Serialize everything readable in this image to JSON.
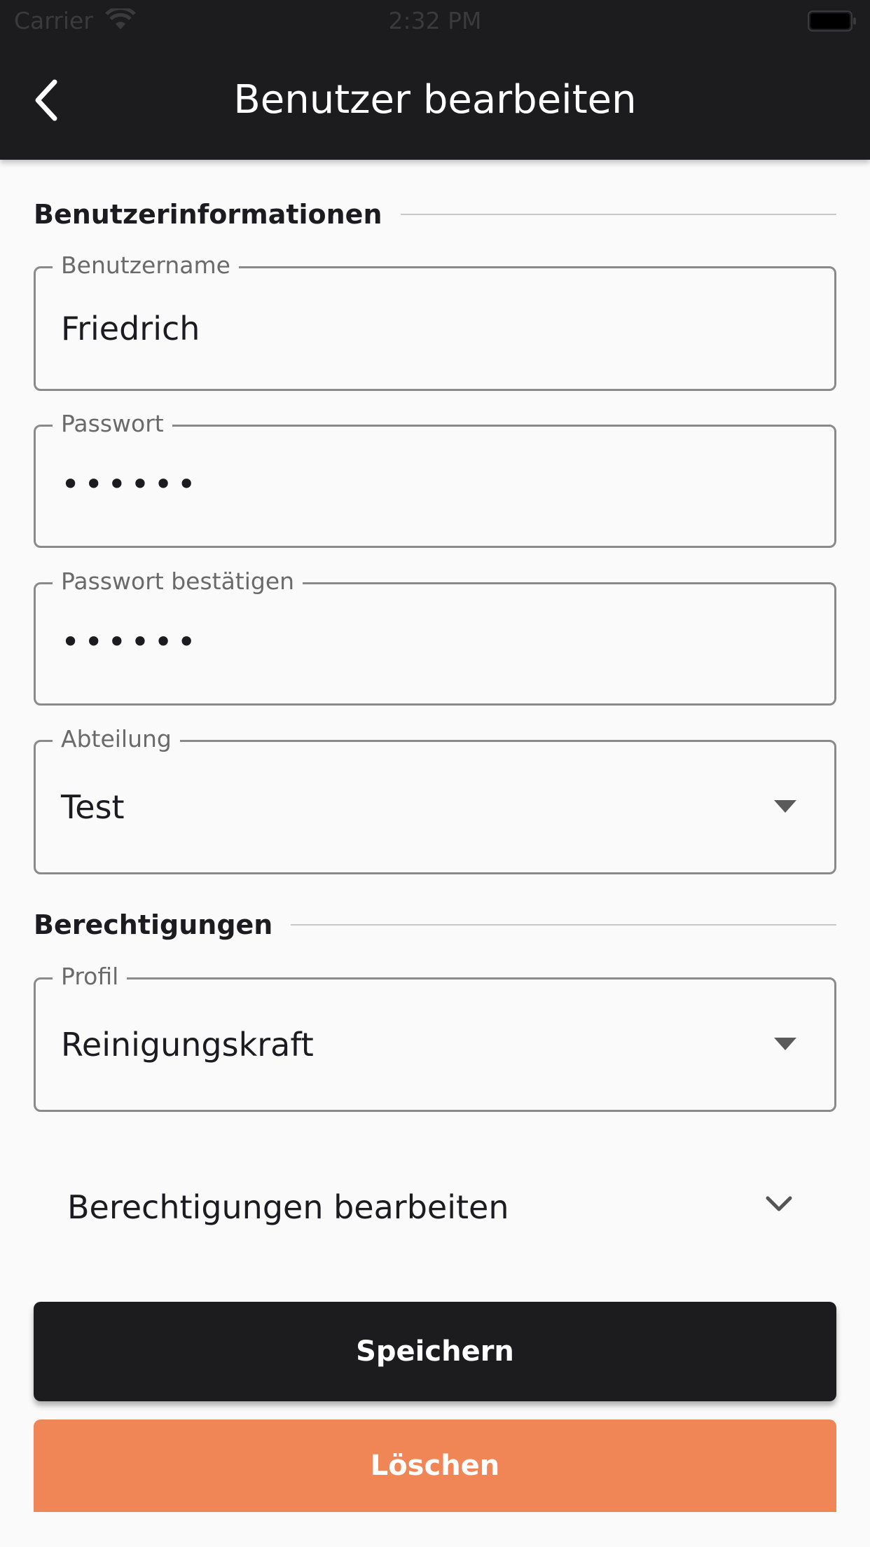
{
  "status_bar": {
    "carrier": "Carrier",
    "time": "2:32 PM"
  },
  "appbar": {
    "title": "Benutzer bearbeiten",
    "back_icon": "chevron-left-icon"
  },
  "section_user": {
    "title": "Benutzerinformationen"
  },
  "fields": {
    "username": {
      "label": "Benutzername",
      "value": "Friedrich"
    },
    "password": {
      "label": "Passwort",
      "value": "••••••"
    },
    "password_confirm": {
      "label": "Passwort bestätigen",
      "value": "••••••"
    },
    "department": {
      "label": "Abteilung",
      "value": "Test"
    }
  },
  "section_permissions": {
    "title": "Berechtigungen"
  },
  "profile": {
    "label": "Profil",
    "value": "Reinigungskraft"
  },
  "expansion": {
    "label": "Berechtigungen bearbeiten"
  },
  "buttons": {
    "save": "Speichern",
    "delete": "Löschen"
  },
  "colors": {
    "appbar": "#1c1b1e",
    "delete": "#f08556",
    "background": "#fafafa"
  }
}
